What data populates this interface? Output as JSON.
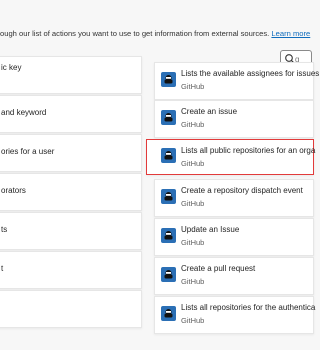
{
  "header": {
    "description": "ough our list of actions you want to use to get information from external sources.",
    "learn_more": "Learn more"
  },
  "search": {
    "placeholder": "g"
  },
  "left_items": [
    {
      "title": "ic key"
    },
    {
      "title": "and keyword"
    },
    {
      "title": "ories for a user"
    },
    {
      "title": "orators"
    },
    {
      "title": "ts"
    },
    {
      "title": "t"
    },
    {
      "title": ""
    }
  ],
  "right_items": [
    {
      "title": "Lists the available assignees for issues",
      "connector": "GitHub"
    },
    {
      "title": "Create an issue",
      "connector": "GitHub"
    },
    {
      "title": "Lists all public repositories for an orga",
      "connector": "GitHub",
      "selected": true
    },
    {
      "title": "Create a repository dispatch event",
      "connector": "GitHub"
    },
    {
      "title": "Update an Issue",
      "connector": "GitHub"
    },
    {
      "title": "Create a pull request",
      "connector": "GitHub"
    },
    {
      "title": "Lists all repositories for the authentica",
      "connector": "GitHub"
    }
  ]
}
